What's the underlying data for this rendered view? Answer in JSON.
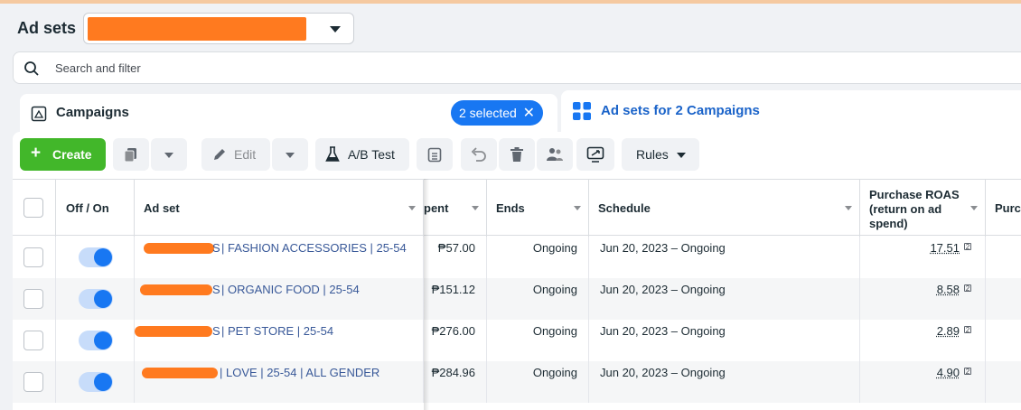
{
  "header": {
    "title": "Ad sets",
    "account_selector": {
      "value_redacted": true
    }
  },
  "search": {
    "placeholder": "Search and filter"
  },
  "tabs": {
    "campaigns": {
      "label": "Campaigns",
      "selected_badge": "2 selected"
    },
    "ad_sets": {
      "label": "Ad sets for 2 Campaigns"
    }
  },
  "toolbar": {
    "create": "Create",
    "edit": "Edit",
    "ab_test": "A/B Test",
    "rules": "Rules"
  },
  "columns": {
    "off_on": "Off / On",
    "ad_set": "Ad set",
    "amount_spent": "pent",
    "ends": "Ends",
    "schedule": "Schedule",
    "purchase_roas": "Purchase ROAS (return on ad spend)",
    "purchases": "Purc"
  },
  "rows": [
    {
      "name": "| FASHION ACCESSORIES | 25-54",
      "name_prefix": "S",
      "on": true,
      "spent": "₱57.00",
      "ends": "Ongoing",
      "schedule": "Jun 20, 2023 – Ongoing",
      "roas": "17.51"
    },
    {
      "name": "| ORGANIC FOOD | 25-54",
      "name_prefix": "S",
      "on": true,
      "spent": "₱151.12",
      "ends": "Ongoing",
      "schedule": "Jun 20, 2023 – Ongoing",
      "roas": "8.58"
    },
    {
      "name": "| PET STORE | 25-54",
      "name_prefix": "S",
      "on": true,
      "spent": "₱276.00",
      "ends": "Ongoing",
      "schedule": "Jun 20, 2023 – Ongoing",
      "roas": "2.89"
    },
    {
      "name": "| LOVE | 25-54 | ALL GENDER",
      "name_prefix": "",
      "on": true,
      "spent": "₱284.96",
      "ends": "Ongoing",
      "schedule": "Jun 20, 2023 – Ongoing",
      "roas": "4.90"
    }
  ],
  "colors": {
    "accent": "#1877f2",
    "create_green": "#42b72a",
    "redaction": "#ff7a1f",
    "link": "#385898"
  }
}
